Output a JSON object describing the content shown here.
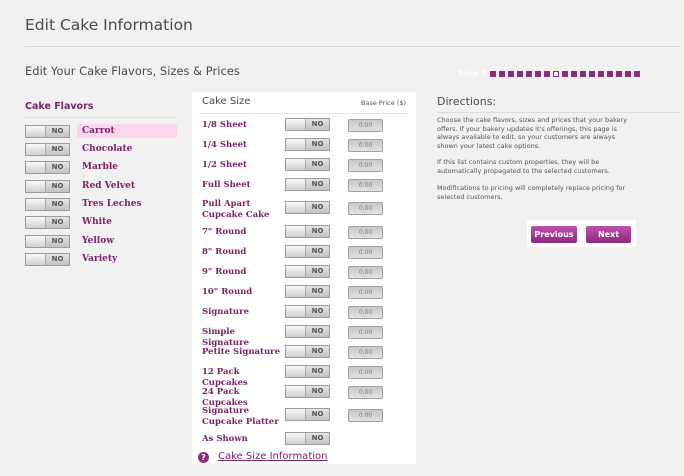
{
  "page_title": "Edit Cake Information",
  "sub_title": "Edit Your Cake Flavors, Sizes & Prices",
  "steps": {
    "label": "Step 7",
    "total": 17,
    "current": 8
  },
  "flavors": {
    "heading": "Cake Flavors",
    "items": [
      {
        "label": "Carrot",
        "toggle": "NO",
        "selected": true
      },
      {
        "label": "Chocolate",
        "toggle": "NO"
      },
      {
        "label": "Marble",
        "toggle": "NO"
      },
      {
        "label": "Red Velvet",
        "toggle": "NO"
      },
      {
        "label": "Tres Leches",
        "toggle": "NO"
      },
      {
        "label": "White",
        "toggle": "NO"
      },
      {
        "label": "Yellow",
        "toggle": "NO"
      },
      {
        "label": "Variety",
        "toggle": "NO"
      }
    ]
  },
  "sizes": {
    "heading": "Cake Size",
    "price_heading": "Base Price ($)",
    "items": [
      {
        "label": "1/8 Sheet",
        "toggle": "NO",
        "price": "0.00"
      },
      {
        "label": "1/4 Sheet",
        "toggle": "NO",
        "price": "0.00"
      },
      {
        "label": "1/2 Sheet",
        "toggle": "NO",
        "price": "0.00"
      },
      {
        "label": "Full Sheet",
        "toggle": "NO",
        "price": "0.00"
      },
      {
        "label": "Pull Apart Cupcake Cake",
        "toggle": "NO",
        "price": "0.00"
      },
      {
        "label": "7\" Round",
        "toggle": "NO",
        "price": "0.00"
      },
      {
        "label": "8\" Round",
        "toggle": "NO",
        "price": "0.00"
      },
      {
        "label": "9\" Round",
        "toggle": "NO",
        "price": "0.00"
      },
      {
        "label": "10\" Round",
        "toggle": "NO",
        "price": "0.00"
      },
      {
        "label": "Signature",
        "toggle": "NO",
        "price": "0.00"
      },
      {
        "label": "Simple Signature",
        "toggle": "NO",
        "price": "0.00"
      },
      {
        "label": "Petite Signature",
        "toggle": "NO",
        "price": "0.00"
      },
      {
        "label": "12 Pack Cupcakes",
        "toggle": "NO",
        "price": "0.00"
      },
      {
        "label": "24 Pack Cupcakes",
        "toggle": "NO",
        "price": "0.00"
      },
      {
        "label": "Signature Cupcake Platter",
        "toggle": "NO",
        "price": "0.00"
      },
      {
        "label": "As Shown",
        "toggle": "NO"
      }
    ],
    "info_icon": "?",
    "info_link": "Cake Size Information"
  },
  "directions": {
    "heading": "Directions:",
    "paragraphs": [
      "Choose the cake flavors, sizes and prices that your bakery offers. If your bakery updates it's offerings, this page is always available to edit, so your customers are always shown your latest cake options.",
      "If this list contains custom properties, they will be automatically propagated to the selected customers.",
      "Modifications to pricing will completely replace pricing for selected customers."
    ]
  },
  "buttons": {
    "previous": "Previous",
    "next": "Next"
  },
  "colors": {
    "brand": "#7a2268",
    "button": "#a8409a",
    "highlight": "#fcd6ea",
    "background": "#f1f1f1"
  }
}
